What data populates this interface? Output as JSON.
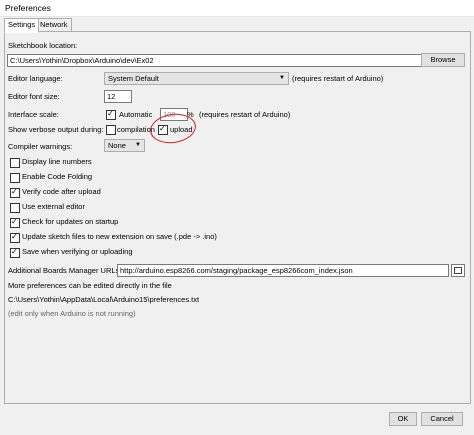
{
  "window": {
    "title": "Preferences"
  },
  "tabs": [
    {
      "label": "Settings"
    },
    {
      "label": "Network"
    }
  ],
  "sketchbook": {
    "label": "Sketchbook location:",
    "value": "C:\\Users\\Yothin\\Dropbox\\Arduino\\dev\\Ex02",
    "browse_label": "Browse"
  },
  "editor_language": {
    "label": "Editor language:",
    "value": "System Default",
    "note": "(requires restart of Arduino)"
  },
  "font_size": {
    "label": "Editor font size:",
    "value": "12"
  },
  "interface_scale": {
    "label": "Interface scale:",
    "automatic_label": "Automatic",
    "automatic_checked": true,
    "value": "100",
    "unit": "%",
    "note": "(requires restart of Arduino)"
  },
  "verbose": {
    "label": "Show verbose output during:",
    "compilation_label": "compilation",
    "compilation_checked": false,
    "upload_label": "upload",
    "upload_checked": true
  },
  "compiler_warnings": {
    "label": "Compiler warnings:",
    "value": "None"
  },
  "options": [
    {
      "label": "Display line numbers",
      "checked": false
    },
    {
      "label": "Enable Code Folding",
      "checked": false
    },
    {
      "label": "Verify code after upload",
      "checked": true
    },
    {
      "label": "Use external editor",
      "checked": false
    },
    {
      "label": "Check for updates on startup",
      "checked": true
    },
    {
      "label": "Update sketch files to new extension on save (.pde -> .ino)",
      "checked": true
    },
    {
      "label": "Save when verifying or uploading",
      "checked": true
    }
  ],
  "boards_manager": {
    "label": "Additional Boards Manager URLs:",
    "value": "http://arduino.esp8266.com/staging/package_esp8266com_index.json"
  },
  "more_prefs": {
    "note": "More preferences can be edited directly in the file",
    "path": "C:\\Users\\Yothin\\AppData\\Local\\Arduino15\\preferences.txt",
    "hint": "(edit only when Arduino is not running)"
  },
  "footer": {
    "ok_label": "OK",
    "cancel_label": "Cancel"
  },
  "colors": {
    "annotation_circle": "#d32020",
    "background": "#f0f0f0"
  }
}
